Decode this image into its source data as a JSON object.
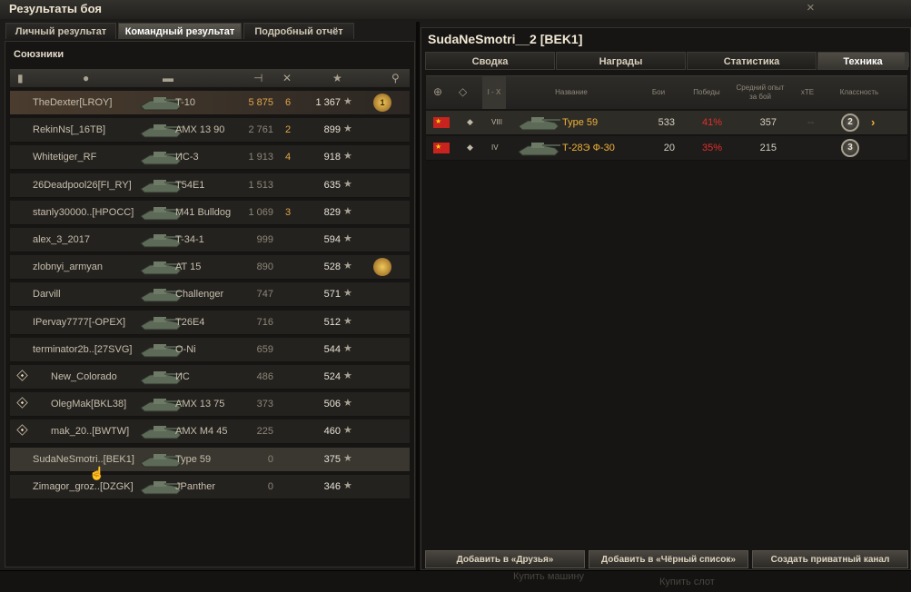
{
  "window": {
    "title": "Результаты боя",
    "close_label": "×"
  },
  "tabs": [
    {
      "label": "Личный результат"
    },
    {
      "label": "Командный результат"
    },
    {
      "label": "Подробный отчёт"
    }
  ],
  "left_panel": {
    "title": "Союзники",
    "rows": [
      {
        "name": "TheDexter[LROY]",
        "vehicle": "T-10",
        "damage": "5 875",
        "frags": "6",
        "xp": "1 367",
        "medal": "1"
      },
      {
        "name": "RekinNs[_16TB]",
        "vehicle": "AMX 13 90",
        "damage": "2 761",
        "frags": "2",
        "xp": "899"
      },
      {
        "name": "Whitetiger_RF",
        "vehicle": "ИС-3",
        "damage": "1 913",
        "frags": "4",
        "xp": "918"
      },
      {
        "name": "26Deadpool26[FI_RY]",
        "vehicle": "T54E1",
        "damage": "1 513",
        "frags": "",
        "xp": "635"
      },
      {
        "name": "stanly30000..[HPOCC]",
        "vehicle": "M41 Bulldog",
        "damage": "1 069",
        "frags": "3",
        "xp": "829"
      },
      {
        "name": "alex_3_2017",
        "vehicle": "T-34-1",
        "damage": "999",
        "frags": "",
        "xp": "594"
      },
      {
        "name": "zlobnyi_armyan",
        "vehicle": "AT 15",
        "damage": "890",
        "frags": "",
        "xp": "528",
        "medal": ""
      },
      {
        "name": "Darvill",
        "vehicle": "Challenger",
        "damage": "747",
        "frags": "",
        "xp": "571"
      },
      {
        "name": "IPervay7777[-OPEX]",
        "vehicle": "T26E4",
        "damage": "716",
        "frags": "",
        "xp": "512"
      },
      {
        "name": "terminator2b..[27SVG]",
        "vehicle": "O-Ni",
        "damage": "659",
        "frags": "",
        "xp": "544"
      },
      {
        "name": "New_Colorado",
        "vehicle": "ИС",
        "damage": "486",
        "frags": "",
        "xp": "524"
      },
      {
        "name": "OlegMak[BKL38]",
        "vehicle": "AMX 13 75",
        "damage": "373",
        "frags": "",
        "xp": "506"
      },
      {
        "name": "mak_20..[BWTW]",
        "vehicle": "AMX M4 45",
        "damage": "225",
        "frags": "",
        "xp": "460"
      },
      {
        "name": "SudaNeSmotri..[BEK1]",
        "vehicle": "Type 59",
        "damage": "0",
        "frags": "",
        "xp": "375"
      },
      {
        "name": "Zimagor_groz..[DZGK]",
        "vehicle": "JPanther",
        "damage": "0",
        "frags": "",
        "xp": "346"
      }
    ]
  },
  "right_panel": {
    "player_title": "SudaNeSmotri__2 [BEK1]",
    "tabs": [
      {
        "label": "Сводка"
      },
      {
        "label": "Награды"
      },
      {
        "label": "Статистика"
      },
      {
        "label": "Техника"
      }
    ],
    "columns": {
      "tier": "I - X",
      "name": "Название",
      "battles": "Бои",
      "wins": "Победы",
      "avg_xp": "Средний опыт за бой",
      "xte": "xTE",
      "mastery": "Классность"
    },
    "vehicles": [
      {
        "tier": "VIII",
        "name": "Type 59",
        "battles": "533",
        "wins": "41%",
        "avg_xp": "357",
        "xte": "--",
        "mastery": "2"
      },
      {
        "tier": "IV",
        "name": "Т-28Э Ф-30",
        "battles": "20",
        "wins": "35%",
        "avg_xp": "215",
        "xte": "",
        "mastery": "3"
      }
    ],
    "buttons": {
      "add_friend": "Добавить в «Друзья»",
      "add_blacklist": "Добавить в «Чёрный список»",
      "private_channel": "Создать приватный канал"
    }
  },
  "background": {
    "buy_vehicle": "Купить машину",
    "buy_slot": "Купить слот"
  }
}
